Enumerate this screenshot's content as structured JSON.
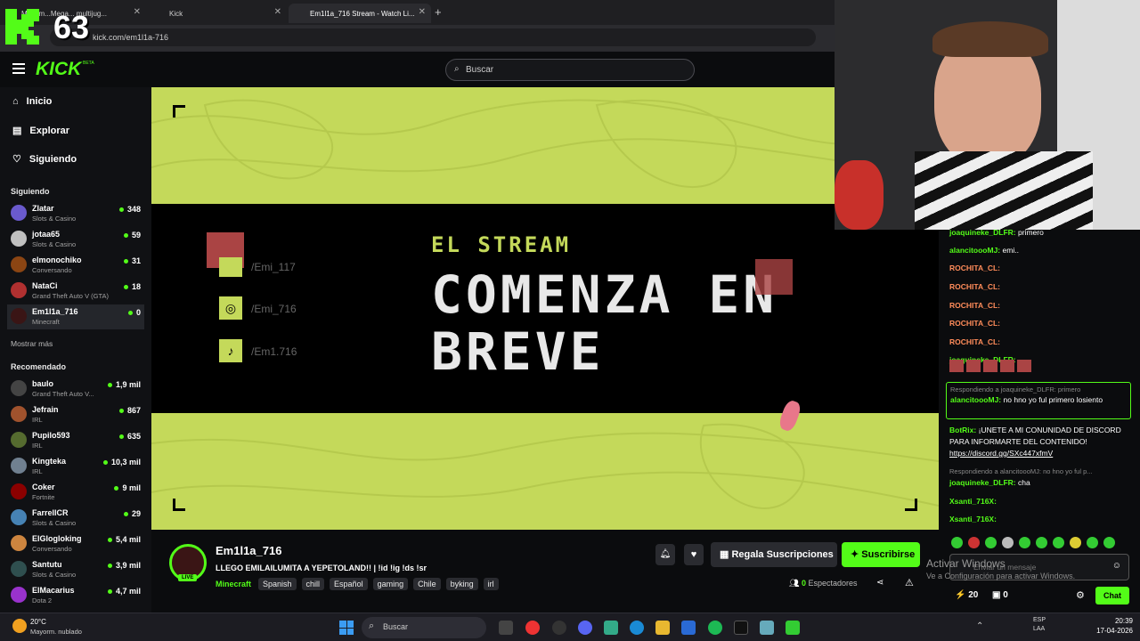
{
  "browser": {
    "tabs": [
      {
        "label": "M: la m...Mega... multijug..."
      },
      {
        "label": "Kick"
      },
      {
        "label": "Em1l1a_716 Stream - Watch Li..."
      }
    ],
    "url": "kick.com/em1l1a-716",
    "overlay_number": "63"
  },
  "header": {
    "logo": "KICK",
    "logo_sup": "BETA",
    "search_placeholder": "Buscar"
  },
  "sidebar": {
    "nav": [
      {
        "label": "Inicio"
      },
      {
        "label": "Explorar"
      },
      {
        "label": "Siguiendo"
      }
    ],
    "following_title": "Siguiendo",
    "following": [
      {
        "name": "Zlatar",
        "category": "Slots & Casino",
        "viewers": "348"
      },
      {
        "name": "jotaa65",
        "category": "Slots & Casino",
        "viewers": "59"
      },
      {
        "name": "elmonochiko",
        "category": "Conversando",
        "viewers": "31"
      },
      {
        "name": "NataCi",
        "category": "Grand Theft Auto V (GTA)",
        "viewers": "18"
      },
      {
        "name": "Em1l1a_716",
        "category": "Minecraft",
        "viewers": "0"
      }
    ],
    "show_more": "Mostrar más",
    "recommended_title": "Recomendado",
    "recommended": [
      {
        "name": "baulo",
        "category": "Grand Theft Auto V...",
        "viewers": "1,9 mil"
      },
      {
        "name": "Jefrain",
        "category": "IRL",
        "viewers": "867"
      },
      {
        "name": "Pupilo593",
        "category": "IRL",
        "viewers": "635"
      },
      {
        "name": "Kingteka",
        "category": "IRL",
        "viewers": "10,3 mil"
      },
      {
        "name": "Coker",
        "category": "Fortnite",
        "viewers": "9 mil"
      },
      {
        "name": "FarrellCR",
        "category": "Slots & Casino",
        "viewers": "29"
      },
      {
        "name": "ElGlogloking",
        "category": "Conversando",
        "viewers": "5,4 mil"
      },
      {
        "name": "Santutu",
        "category": "Slots & Casino",
        "viewers": "3,9 mil"
      },
      {
        "name": "ElMacarius",
        "category": "Dota 2",
        "viewers": "4,7 mil"
      }
    ]
  },
  "video": {
    "line1": "EL STREAM",
    "line2": "COMENZA EN",
    "line3": "BREVE",
    "socials": [
      "/Emi_117",
      "/Emi_716",
      "/Em1.716"
    ]
  },
  "stream": {
    "name": "Em1l1a_716",
    "live": "LIVE",
    "title": "LLEGO EMILAILUMITA A YEPETOLAND!! | !id !ig !ds !sr",
    "category": "Minecraft",
    "tags": [
      "Spanish",
      "chill",
      "Español",
      "gaming",
      "Chile",
      "byking",
      "irl"
    ],
    "gift_label": "Regala Suscripciones",
    "subscribe_label": "Suscribirse",
    "viewers": "0",
    "viewers_label": "Espectadores"
  },
  "chat": {
    "messages": [
      {
        "user": "joaquineke_DLFR:",
        "text": "primero",
        "color": "#53fc18"
      },
      {
        "user": "alancitoooMJ:",
        "text": "emi..",
        "color": "#53fc18"
      },
      {
        "user": "ROCHITA_CL:",
        "text": "",
        "color": "#ff8c5a"
      },
      {
        "user": "ROCHITA_CL:",
        "text": "",
        "color": "#ff8c5a"
      },
      {
        "user": "ROCHITA_CL:",
        "text": "",
        "color": "#ff8c5a"
      },
      {
        "user": "ROCHITA_CL:",
        "text": "",
        "color": "#ff8c5a"
      },
      {
        "user": "ROCHITA_CL:",
        "text": "",
        "color": "#ff8c5a"
      },
      {
        "user": "joaquineke_DLFR:",
        "text": "",
        "color": "#53fc18"
      }
    ],
    "reply1": "Respondiendo a joaquineke_DLFR: primero",
    "reply1_user": "alancitoooMJ:",
    "reply1_text": "no hno yo ful primero losiento",
    "botrix_user": "BotRix:",
    "botrix_text": "¡UNETE A MI CONUNIDAD DE DISCORD PARA INFORMARTE DEL CONTENIDO!",
    "botrix_link": "https://discord.gg/SXc447xfmV",
    "reply2": "Respondiendo a alancitoooMJ: no hno yo ful p...",
    "reply2_user": "joaquineke_DLFR:",
    "reply2_text": "cha",
    "x1_user": "Xsanti_716X:",
    "x2_user": "Xsanti_716X:",
    "input_placeholder": "Enviar un mensaje",
    "watermark1": "Activar Windows",
    "watermark2": "Ve a Configuración para activar Windows.",
    "points": "20",
    "gifts": "0",
    "chat_button": "Chat"
  },
  "taskbar": {
    "temp": "20°C",
    "weather": "Mayorm. nublado",
    "search": "Buscar",
    "lang1": "ESP",
    "lang2": "LAA",
    "time": "20:39",
    "date": "17-04-2026"
  },
  "colors": {
    "kick_green": "#53fc18",
    "screen_green": "#c4d95a"
  }
}
